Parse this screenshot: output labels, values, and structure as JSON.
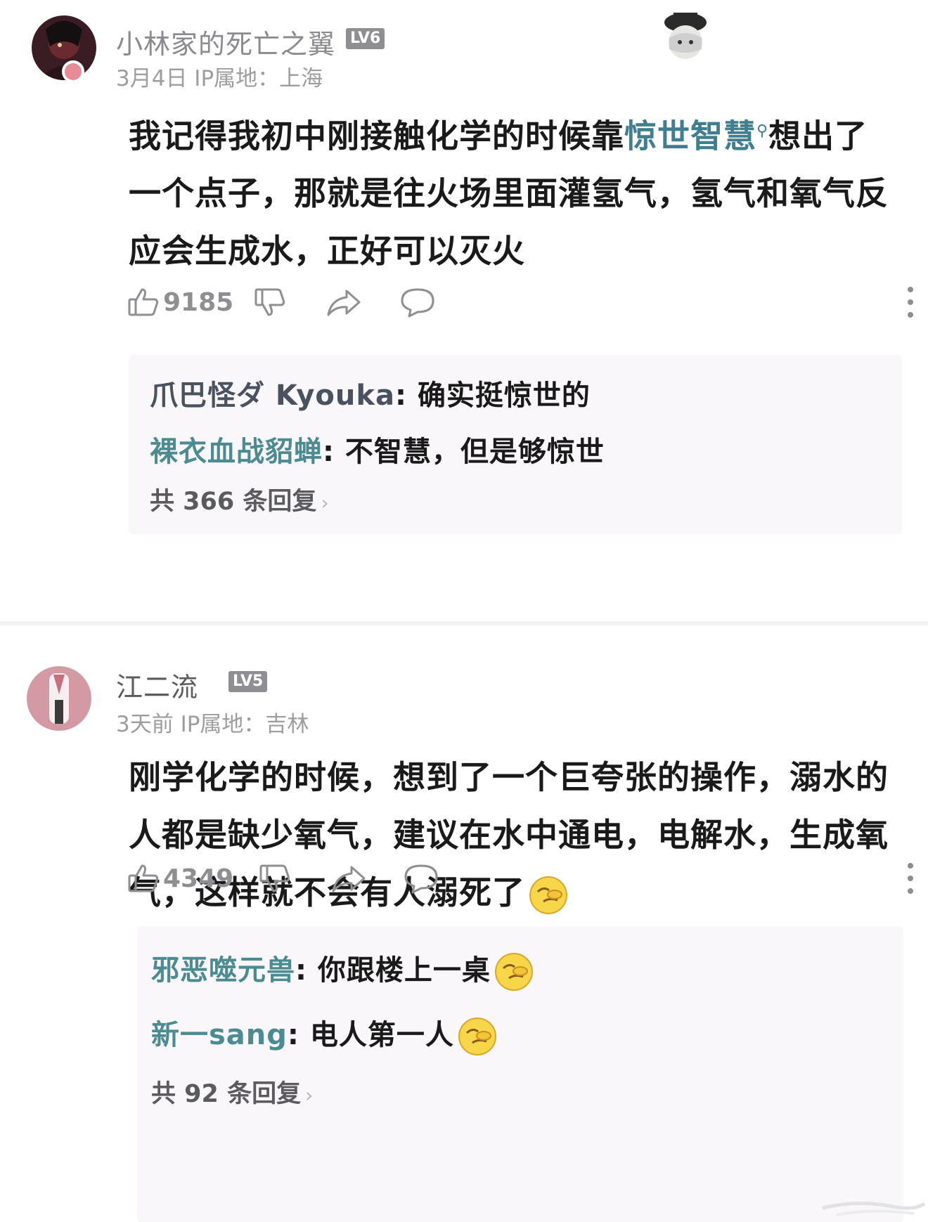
{
  "comments": [
    {
      "username": "小林家的死亡之翼",
      "level": "LV6",
      "meta": "3月4日  IP属地：上海",
      "body": {
        "before": "我记得我初中刚接触化学的时候靠",
        "link": "惊世智慧",
        "after": "想出了一个点子，那就是往火场里面灌氢气，氢气和氧气反应会生成水，正好可以灭火"
      },
      "likes": "9185",
      "replies": [
        {
          "name": "爪巴怪ダ Kyouka",
          "separator": ": ",
          "text": "确实挺惊世的"
        },
        {
          "name": "裸衣血战貂蝉",
          "separator": ": ",
          "text": "不智慧，但是够惊世"
        }
      ],
      "reply_total": "共 366 条回复"
    },
    {
      "username": "江二流",
      "level": "LV5",
      "meta": "3天前  IP属地：吉林",
      "body": {
        "text": "刚学化学的时候，想到了一个巨夸张的操作，溺水的人都是缺少氧气，建议在水中通电，电解水，生成氧气，这样就不会有人溺死了"
      },
      "likes": "4349",
      "replies": [
        {
          "name": "邪恶噬元兽",
          "separator": ": ",
          "text": "你跟楼上一桌"
        },
        {
          "name": "新一sang",
          "separator": ": ",
          "text": "电人第一人"
        }
      ],
      "reply_total": "共 92 条回复"
    }
  ],
  "icons": {
    "like": "thumbs-up-icon",
    "dislike": "thumbs-down-icon",
    "share": "share-arrow-icon",
    "reply": "speech-bubble-icon",
    "more": "more-vertical-icon",
    "search": "search-icon",
    "emoji": "facepalm-emoji-icon",
    "chevron": "chevron-right-icon"
  },
  "colors": {
    "link": "#3f7f8f",
    "meta": "#9d9d9d",
    "reply_bg": "#faf7fa",
    "level_badge": "#8e8e93"
  }
}
